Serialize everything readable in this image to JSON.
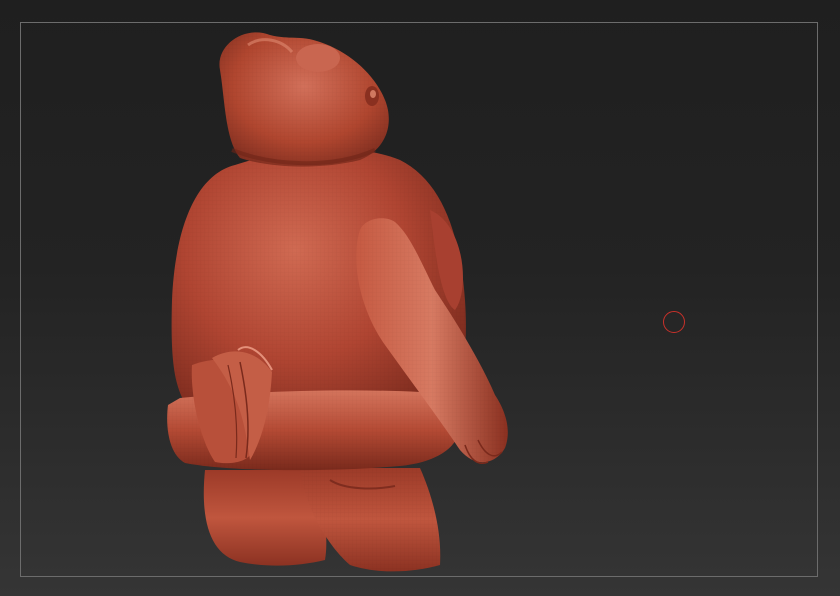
{
  "canvas": {
    "background_top": "#1f1f1f",
    "background_bottom": "#353535",
    "frame_color": "#6c6c6c"
  },
  "model": {
    "name": "sculpt-model",
    "material_color": "#b64a35",
    "highlight_color": "#d8735a",
    "shadow_color": "#6e2418"
  },
  "cursor": {
    "icon": "brush-circle-icon",
    "color": "#c8312a"
  }
}
